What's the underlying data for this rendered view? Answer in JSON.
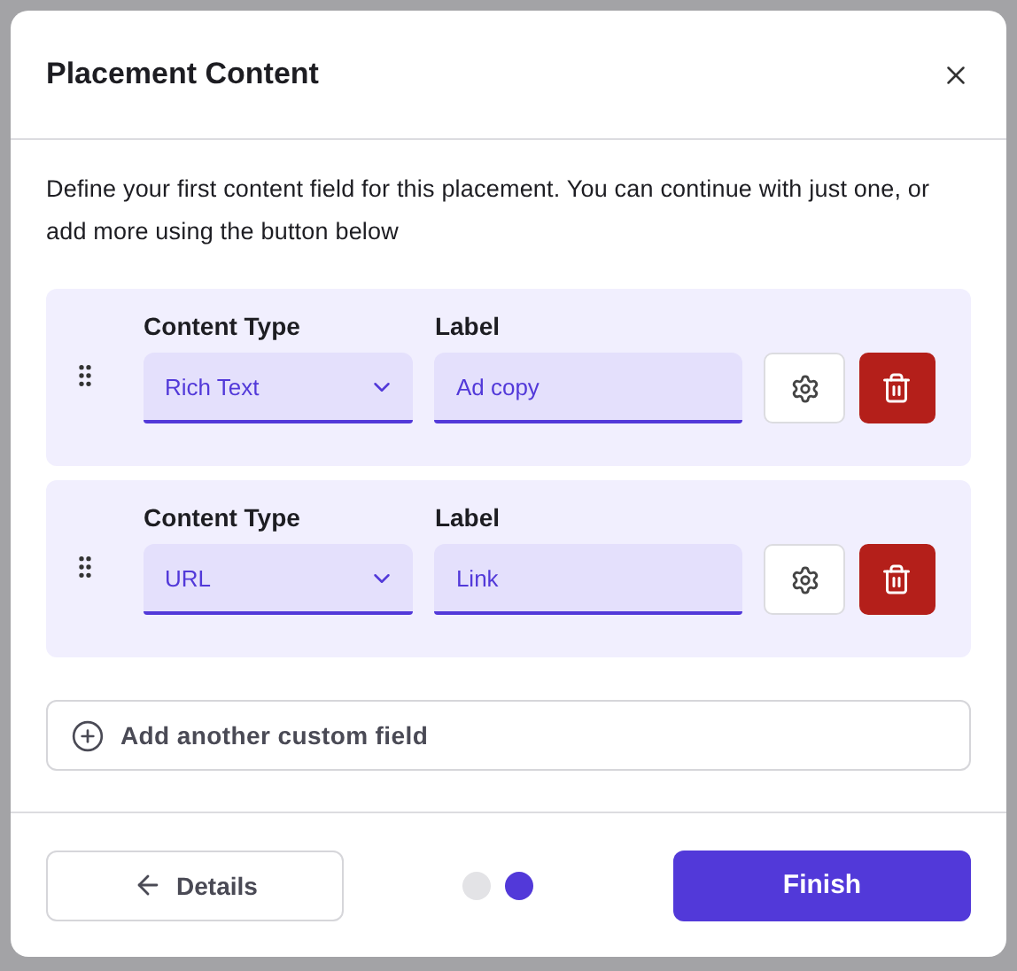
{
  "dialog": {
    "title": "Placement Content",
    "description": "Define your first content field for this placement. You can continue with just one, or add more using the button below",
    "fields": [
      {
        "type_heading": "Content Type",
        "content_type": "Rich Text",
        "label_heading": "Label",
        "label": "Ad copy"
      },
      {
        "type_heading": "Content Type",
        "content_type": "URL",
        "label_heading": "Label",
        "label": "Link"
      }
    ],
    "add_button": "Add another custom field",
    "back_button": "Details",
    "steps": [
      {
        "selected": false
      },
      {
        "selected": true
      }
    ],
    "finish_button": "Finish"
  }
}
